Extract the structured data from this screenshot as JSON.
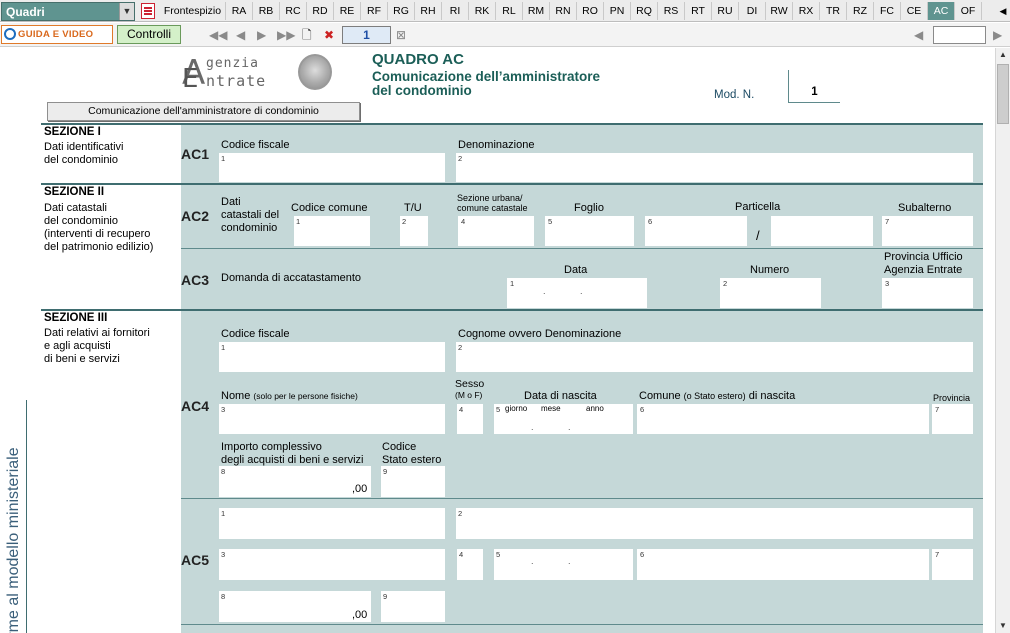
{
  "topbar": {
    "quadri_combo": "Quadri",
    "tabs": [
      "Frontespizio",
      "RA",
      "RB",
      "RC",
      "RD",
      "RE",
      "RF",
      "RG",
      "RH",
      "RI",
      "RK",
      "RL",
      "RM",
      "RN",
      "RO",
      "PN",
      "RQ",
      "RS",
      "RT",
      "RU",
      "DI",
      "RW",
      "RX",
      "TR",
      "RZ",
      "FC",
      "CE",
      "AC",
      "OF"
    ],
    "active_tab": "AC"
  },
  "toolbar": {
    "guida_label": "GUIDA E VIDEO",
    "controlli_label": "Controlli",
    "page_number": "1"
  },
  "header": {
    "logo_line1": "genzia",
    "logo_line2": "ntrate",
    "logo_letters": "AE",
    "quadro_title": "QUADRO AC",
    "subtitle_line1": "Comunicazione dell’amministratore",
    "subtitle_line2": "del condominio",
    "mod_label": "Mod. N.",
    "mod_value": "1",
    "section_button": "Comunicazione dell'amministratore di condominio"
  },
  "side_vertical_text": "forme al modello ministeriale",
  "sections": {
    "s1": {
      "title": "SEZIONE I",
      "desc": [
        "Dati identificativi",
        "del condominio"
      ]
    },
    "s2": {
      "title": "SEZIONE II",
      "desc": [
        "Dati catastali",
        "del condominio",
        "(interventi di recupero",
        "del patrimonio edilizio)"
      ]
    },
    "s3": {
      "title": "SEZIONE III",
      "desc": [
        "Dati relativi ai fornitori",
        "e agli acquisti",
        "di beni e servizi"
      ]
    }
  },
  "rows": {
    "ac1": {
      "code": "AC1",
      "codice_fiscale": "Codice fiscale",
      "denominazione": "Denominazione"
    },
    "ac2": {
      "code": "AC2",
      "dati_catastali": [
        "Dati",
        "catastali del",
        "condominio"
      ],
      "codice_comune": "Codice comune",
      "tu": "T/U",
      "sezione_urbana": [
        "Sezione urbana/",
        "comune catastale"
      ],
      "foglio": "Foglio",
      "particella": "Particella",
      "slash": "/",
      "subalterno": "Subalterno"
    },
    "ac3": {
      "code": "AC3",
      "domanda": "Domanda di accatastamento",
      "data": "Data",
      "numero": "Numero",
      "provincia": [
        "Provincia Ufficio",
        "Agenzia Entrate"
      ]
    },
    "ac4": {
      "code": "AC4",
      "codice_fiscale": "Codice fiscale",
      "cognome": "Cognome ovvero Denominazione",
      "nome": "Nome",
      "nome_note": "(solo per le persone fisiche)",
      "sesso": [
        "Sesso",
        "(M o F)"
      ],
      "data_nascita": "Data di nascita",
      "giorno": "giorno",
      "mese": "mese",
      "anno": "anno",
      "comune": "Comune",
      "comune_note": "(o Stato estero)",
      "comune_tail": "di nascita",
      "provincia": "Provincia",
      "importo": [
        "Importo complessivo",
        "degli acquisti di beni e servizi"
      ],
      "codice_stato": [
        "Codice",
        "Stato estero"
      ],
      "importo_value": ",00"
    },
    "ac5": {
      "code": "AC5",
      "importo_value": ",00"
    }
  },
  "field_numbers": {
    "n1": "1",
    "n2": "2",
    "n3": "3",
    "n4": "4",
    "n5": "5",
    "n6": "6",
    "n7": "7",
    "n8": "8",
    "n9": "9"
  }
}
